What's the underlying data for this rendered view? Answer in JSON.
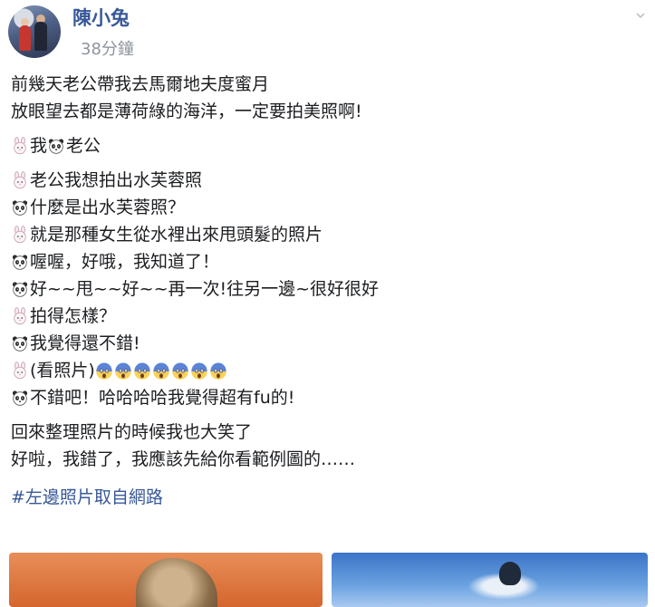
{
  "post": {
    "author": "陳小兔",
    "timestamp": "38分鐘",
    "options_icon": "chevron-down-icon",
    "intro": [
      "前幾天老公帶我去馬爾地夫度蜜月",
      "放眼望去都是薄荷綠的海洋，一定要拍美照啊!"
    ],
    "cast": {
      "wife": "我",
      "husband": "老公"
    },
    "dialogue": [
      {
        "speaker": "wife",
        "text": "老公我想拍出水芙蓉照"
      },
      {
        "speaker": "husband",
        "text": "什麼是出水芙蓉照？"
      },
      {
        "speaker": "wife",
        "text": "就是那種女生從水裡出來甩頭髮的照片"
      },
      {
        "speaker": "husband",
        "text": "喔喔，好哦，我知道了！"
      },
      {
        "speaker": "husband",
        "text": "好~~甩~~好~~再一次!往另一邊~很好很好"
      },
      {
        "speaker": "wife",
        "text": "拍得怎樣？"
      },
      {
        "speaker": "husband",
        "text": "我覺得還不錯!"
      },
      {
        "speaker": "wife",
        "text": "(看照片)"
      },
      {
        "speaker": "husband",
        "text": "不錯吧！哈哈哈哈我覺得超有fu的!"
      }
    ],
    "outro": [
      "回來整理照片的時候我也大笑了",
      "好啦，我錯了，我應該先給你看範例圖的……"
    ],
    "hashtag": "#左邊照片取自網路",
    "scream_count": 7,
    "emoji_icons": {
      "wife": "rabbit-emoji-icon",
      "husband": "panda-emoji-icon",
      "scream": "scream-emoji-icon"
    }
  }
}
